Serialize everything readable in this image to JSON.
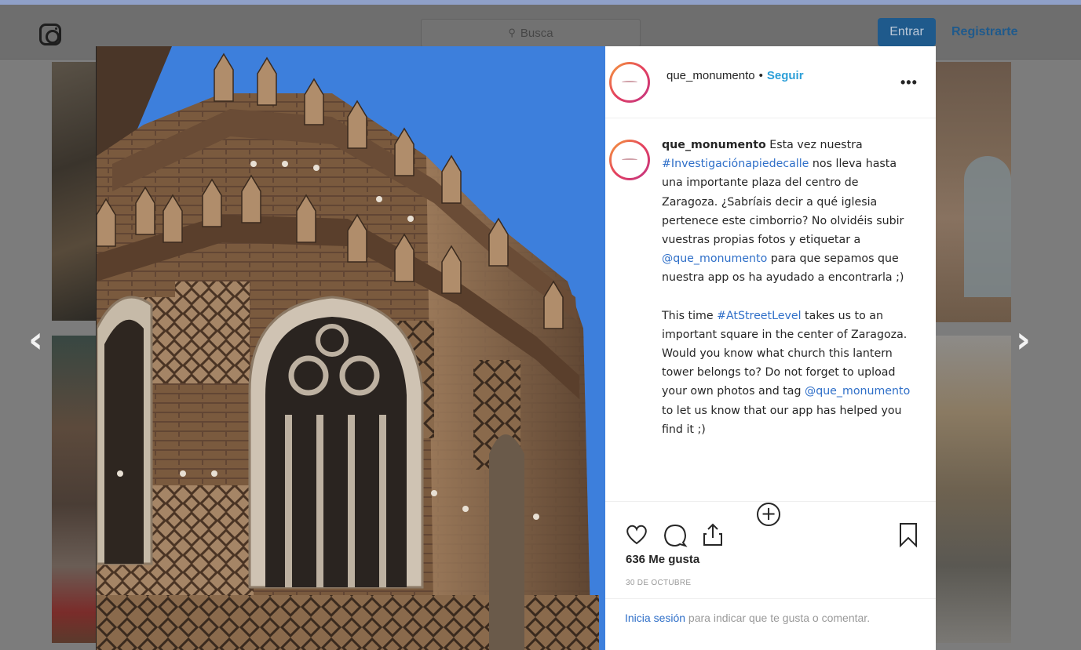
{
  "header": {
    "search_placeholder": "Busca",
    "login_label": "Entrar",
    "register_label": "Registrarte"
  },
  "post": {
    "username": "que_monumento",
    "separator": "•",
    "follow_label": "Seguir",
    "more_label": "•••",
    "caption": {
      "username": "que_monumento",
      "es_part1": " Esta vez nuestra ",
      "es_tag": "#Investigaciónapiedecalle",
      "es_part2": " nos lleva hasta una importante plaza del centro de Zaragoza.  ¿Sabríais decir a qué iglesia pertenece este cimborrio? No olvidéis subir vuestras propias fotos y etiquetar a ",
      "es_mention": "@que_monumento",
      "es_part3": " para que sepamos que nuestra app os ha ayudado a encontrarla ;)",
      "en_part1": "This time ",
      "en_tag": "#AtStreetLevel",
      "en_part2": " takes us to an important  square in the center of Zaragoza.  Would you know what church this lantern tower belongs to? Do not forget to upload  your own photos and tag ",
      "en_mention": "@que_monumento",
      "en_part3": " to let us know that our app has helped you find it ;)"
    },
    "load_more_label": "+",
    "likes": "636 Me gusta",
    "date": "30 DE OCTUBRE",
    "login_link": "Inicia sesión",
    "login_rest": " para indicar que te gusta o comentar."
  },
  "navigation": {
    "prev_label": "‹",
    "next_label": "›"
  },
  "colors": {
    "follow": "#2c9fd8",
    "hashtag": "#2f6fc8",
    "login_button": "#1f5a8c",
    "sky": "#3a7ad8"
  },
  "icons": [
    "instagram-logo-icon",
    "search-icon",
    "heart-icon",
    "comment-icon",
    "share-icon",
    "bookmark-icon",
    "plus-circle-icon",
    "chevron-left-icon",
    "chevron-right-icon"
  ]
}
